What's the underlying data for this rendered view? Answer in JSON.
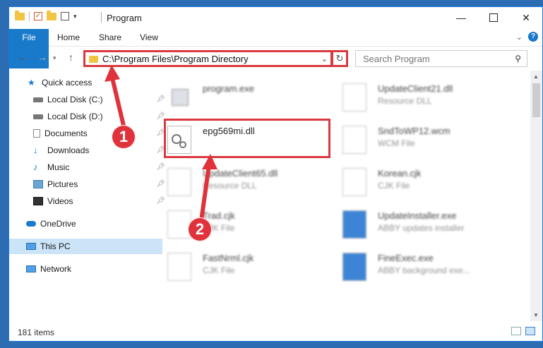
{
  "window": {
    "title": "Program"
  },
  "ribbon": {
    "tabs": [
      "File",
      "Home",
      "Share",
      "View"
    ]
  },
  "address": {
    "path": "C:\\Program Files\\Program Directory"
  },
  "search": {
    "placeholder": "Search Program"
  },
  "sidebar": {
    "items": [
      {
        "label": "Quick access",
        "icon": "star-icon"
      },
      {
        "label": "Local Disk (C:)",
        "icon": "drive-icon",
        "pinned": true
      },
      {
        "label": "Local Disk (D:)",
        "icon": "drive-icon",
        "pinned": true
      },
      {
        "label": "Documents",
        "icon": "documents-icon",
        "pinned": true
      },
      {
        "label": "Downloads",
        "icon": "downloads-icon",
        "pinned": true
      },
      {
        "label": "Music",
        "icon": "music-icon",
        "pinned": true
      },
      {
        "label": "Pictures",
        "icon": "pictures-icon",
        "pinned": true
      },
      {
        "label": "Videos",
        "icon": "videos-icon",
        "pinned": true
      },
      {
        "label": "OneDrive",
        "icon": "cloud-icon"
      },
      {
        "label": "This PC",
        "icon": "pc-icon",
        "selected": true
      },
      {
        "label": "Network",
        "icon": "network-icon"
      }
    ]
  },
  "files": [
    {
      "name": "program.exe",
      "type": "",
      "icon": "app-icon"
    },
    {
      "name": "UpdateClient21.dll",
      "type": "Resource DLL",
      "icon": "dll-icon"
    },
    {
      "name": "epg569mi.dll",
      "type": "",
      "icon": "dll-gear-icon"
    },
    {
      "name": "SndToWP12.wcm",
      "type": "WCM File",
      "icon": "file-icon"
    },
    {
      "name": "UpdateClient65.dll",
      "type": "Resource DLL",
      "icon": "dll-icon"
    },
    {
      "name": "Korean.cjk",
      "type": "CJK File",
      "icon": "file-icon"
    },
    {
      "name": "Trad.cjk",
      "type": "CJK File",
      "icon": "file-icon"
    },
    {
      "name": "UpdateInstaller.exe",
      "type": "ABBY updates installer",
      "icon": "exe-icon"
    },
    {
      "name": "FastNrml.cjk",
      "type": "CJK File",
      "icon": "file-icon"
    },
    {
      "name": "FineExec.exe",
      "type": "ABBY background exe...",
      "icon": "exe-icon"
    }
  ],
  "status": {
    "item_count": "181 items"
  },
  "annotations": {
    "step1": "1",
    "step2": "2"
  },
  "colors": {
    "accent": "#1979ca",
    "highlight": "#d9393f"
  }
}
